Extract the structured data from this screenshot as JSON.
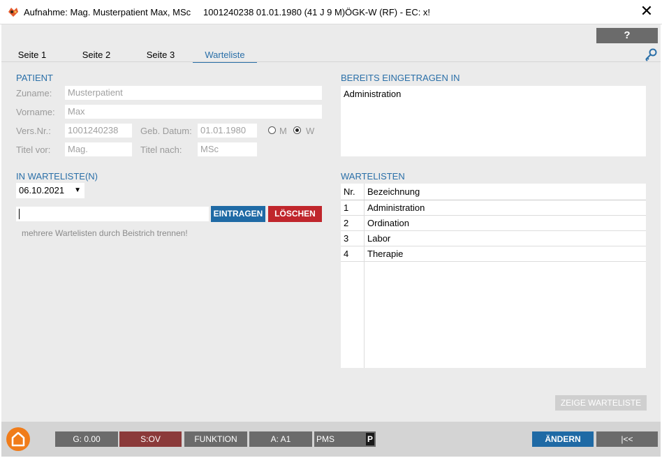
{
  "titlebar": {
    "title": "Aufnahme: Mag. Musterpatient Max, MSc",
    "patient_info": "1001240238 01.01.1980 (41 J 9 M)",
    "insurance": "ÖGK-W (RF) - EC: x!",
    "close": "✕"
  },
  "help": {
    "label": "?"
  },
  "tabs": [
    {
      "label": "Seite 1"
    },
    {
      "label": "Seite 2"
    },
    {
      "label": "Seite 3"
    },
    {
      "label": "Warteliste"
    }
  ],
  "patient": {
    "heading": "PATIENT",
    "zuname_label": "Zuname:",
    "zuname": "Musterpatient",
    "vorname_label": "Vorname:",
    "vorname": "Max",
    "versnr_label": "Vers.Nr.:",
    "versnr": "1001240238",
    "gebdatum_label": "Geb. Datum:",
    "gebdatum": "01.01.1980",
    "gender_m": "M",
    "gender_w": "W",
    "titel_vor_label": "Titel vor:",
    "titel_vor": "Mag.",
    "titel_nach_label": "Titel nach:",
    "titel_nach": "MSc"
  },
  "in_warteliste": {
    "heading": "IN WARTELISTE(N)",
    "date": "06.10.2021",
    "input_value": "",
    "eintragen": "EINTRAGEN",
    "loeschen": "LÖSCHEN",
    "hint": "mehrere Wartelisten durch Beistrich trennen!"
  },
  "bereits": {
    "heading": "BEREITS EINGETRAGEN IN",
    "entries": [
      "Administration"
    ]
  },
  "wartelisten": {
    "heading": "WARTELISTEN",
    "col_nr": "Nr.",
    "col_bez": "Bezeichnung",
    "rows": [
      {
        "nr": "1",
        "name": "Administration"
      },
      {
        "nr": "2",
        "name": "Ordination"
      },
      {
        "nr": "3",
        "name": "Labor"
      },
      {
        "nr": "4",
        "name": "Therapie"
      }
    ]
  },
  "zeige_warteliste": "ZEIGE WARTELISTE",
  "statusbar": {
    "g": "G: 0.00",
    "s": "S:OV",
    "funktion": "FUNKTION",
    "a": "A: A1",
    "pms": "PMS",
    "p": "P",
    "aendern": "ÄNDERN",
    "first": "|<<"
  },
  "colors": {
    "accent": "#2a6fa8",
    "danger": "#c0262c",
    "s_button": "#8b3a3a",
    "home_icon": "#f07c1a"
  }
}
